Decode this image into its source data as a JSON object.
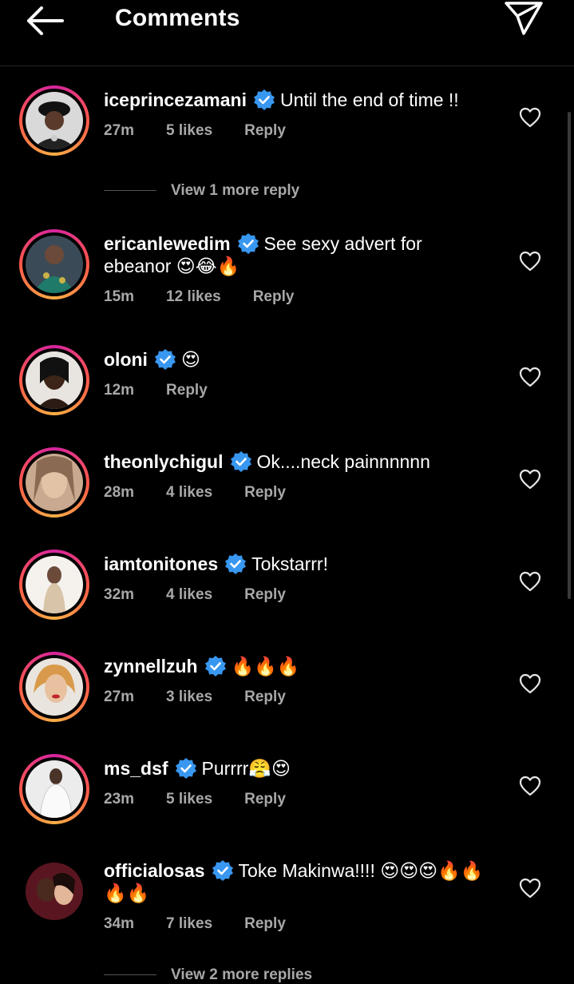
{
  "header": {
    "title": "Comments",
    "back_icon": "arrow-left-icon",
    "share_icon": "paper-plane-icon"
  },
  "comments": [
    {
      "username": "iceprincezamani",
      "verified": true,
      "text": "Until the end of time !!",
      "time": "27m",
      "likes": "5 likes",
      "reply": "Reply"
    },
    {
      "username": "ericanlewedim",
      "verified": true,
      "text": "See sexy advert for ebeanor 😍😂🔥",
      "time": "15m",
      "likes": "12 likes",
      "reply": "Reply"
    },
    {
      "username": "oloni",
      "verified": true,
      "text": "😍",
      "time": "12m",
      "likes": "",
      "reply": "Reply"
    },
    {
      "username": "theonlychigul",
      "verified": true,
      "text": "Ok....neck painnnnnn",
      "time": "28m",
      "likes": "4 likes",
      "reply": "Reply"
    },
    {
      "username": "iamtonitones",
      "verified": true,
      "text": "Tokstarrr!",
      "time": "32m",
      "likes": "4 likes",
      "reply": "Reply"
    },
    {
      "username": "zynnellzuh",
      "verified": true,
      "text": "🔥🔥🔥",
      "time": "27m",
      "likes": "3 likes",
      "reply": "Reply"
    },
    {
      "username": "ms_dsf",
      "verified": true,
      "text": "Purrrr😤😍",
      "time": "23m",
      "likes": "5 likes",
      "reply": "Reply"
    },
    {
      "username": "officialosas",
      "verified": true,
      "text": "Toke Makinwa!!!! 😍😍😍🔥🔥🔥🔥",
      "time": "34m",
      "likes": "7 likes",
      "reply": "Reply"
    }
  ],
  "view_replies": [
    "View 1 more reply",
    "View 2 more replies"
  ],
  "colors": {
    "background": "#000000",
    "verified": "#3897f0",
    "meta": "#a8a8a8"
  }
}
